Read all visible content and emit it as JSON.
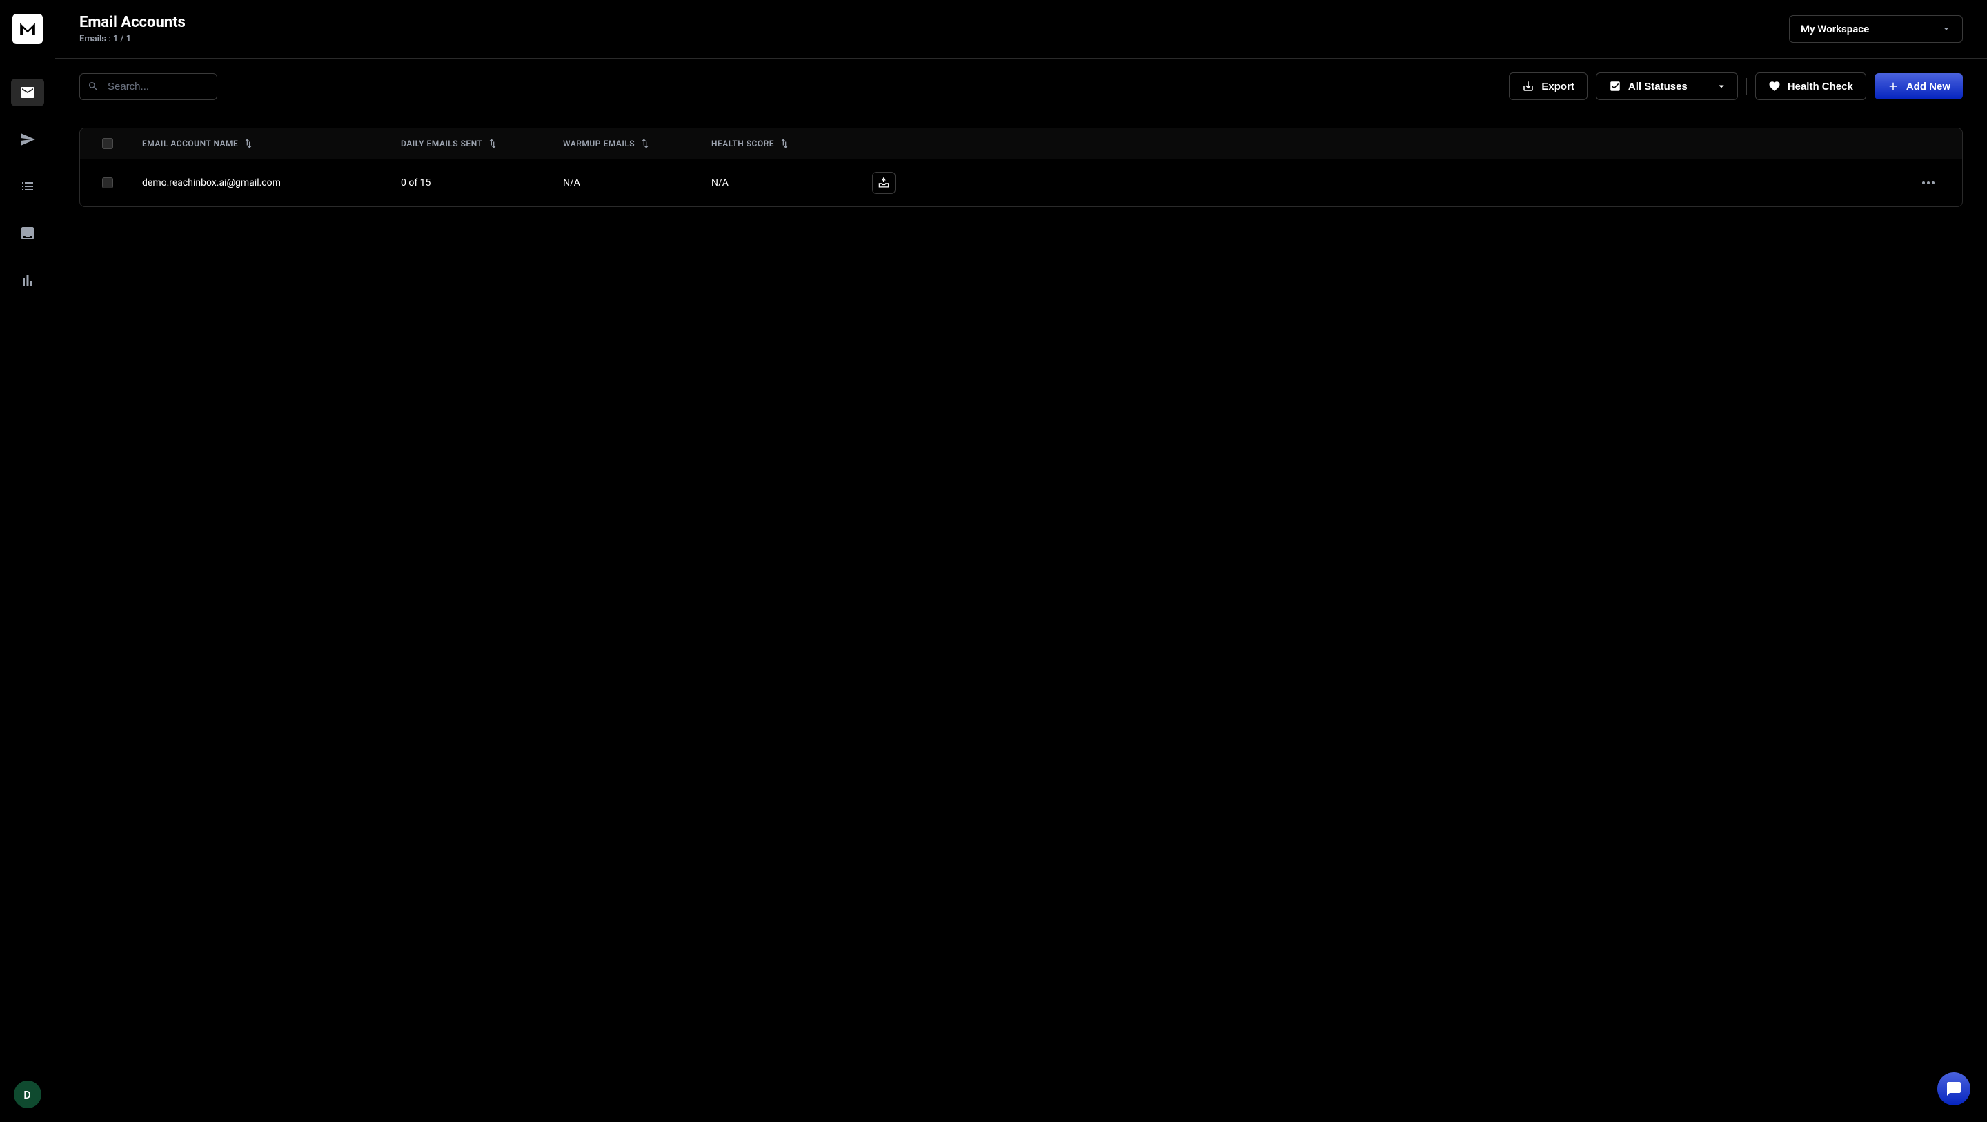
{
  "header": {
    "title": "Email Accounts",
    "subtitle": "Emails : 1 / 1",
    "workspace": "My Workspace"
  },
  "toolbar": {
    "search_placeholder": "Search...",
    "export_label": "Export",
    "status_label": "All Statuses",
    "health_check_label": "Health Check",
    "add_new_label": "Add New"
  },
  "table": {
    "columns": {
      "name": "EMAIL ACCOUNT NAME",
      "daily": "DAILY EMAILS SENT",
      "warmup": "WARMUP EMAILS",
      "health": "HEALTH SCORE"
    },
    "rows": [
      {
        "email": "demo.reachinbox.ai@gmail.com",
        "daily": "0 of 15",
        "warmup": "N/A",
        "health": "N/A"
      }
    ]
  },
  "avatar": {
    "initial": "D"
  }
}
